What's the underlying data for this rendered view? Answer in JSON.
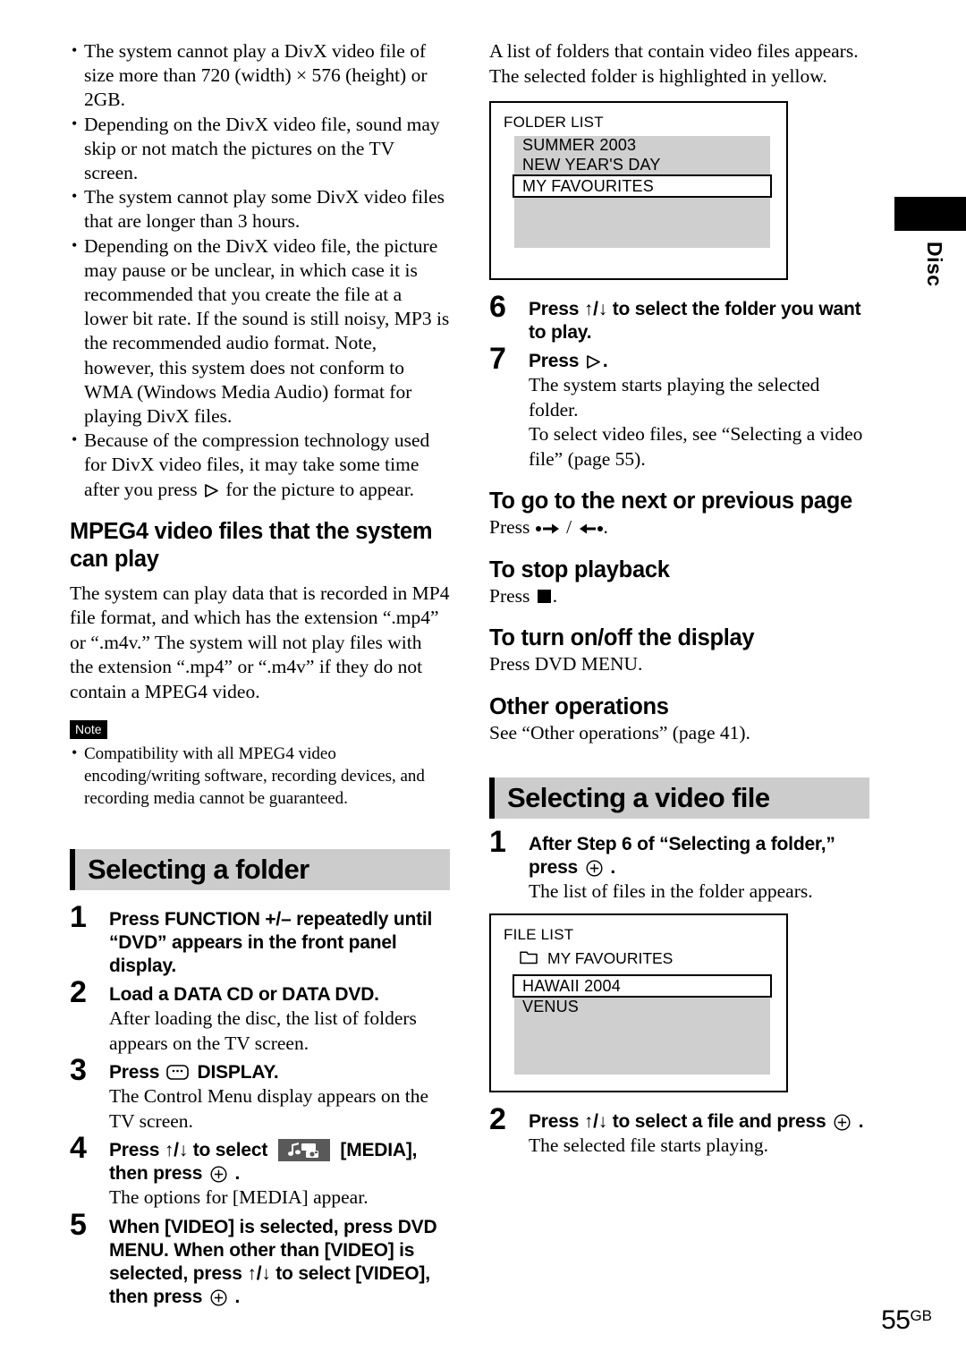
{
  "document": {
    "page_number": "55",
    "page_suffix": "GB",
    "side_tab_label": "Disc"
  },
  "left_column": {
    "intro_bullets": [
      "The system cannot play a DivX video file of size more than 720 (width) × 576 (height) or 2GB.",
      "Depending on the DivX video file, sound may skip or not match the pictures on the TV screen.",
      "The system cannot play some DivX video files that are longer than 3 hours.",
      "Depending on the DivX video file, the picture may pause or be unclear, in which case it is recommended that you create the file at a lower bit rate. If the sound is still noisy, MP3 is the recommended audio format. Note, however, this system does not conform to WMA (Windows Media Audio) format for playing DivX files."
    ],
    "bullet_compression_before": "Because of the compression technology used for DivX video files, it may take some time after you press ",
    "bullet_compression_after": " for the picture to appear.",
    "mpeg4_heading": "MPEG4 video files that the system can play",
    "mpeg4_paragraph": "The system can play data that is recorded in MP4 file format, and which has the extension “.mp4” or “.m4v.” The system will not play files with the extension “.mp4” or “.m4v” if they do not contain a MPEG4 video.",
    "note_label": "Note",
    "note_bullets": [
      "Compatibility with all MPEG4 video encoding/writing software, recording devices, and recording media cannot be guaranteed."
    ],
    "section_heading": "Selecting a folder",
    "steps": [
      {
        "number": "1",
        "instruction": "Press FUNCTION +/– repeatedly until “DVD” appears in the front panel display.",
        "body": ""
      },
      {
        "number": "2",
        "instruction": "Load a DATA CD or DATA DVD.",
        "body": "After loading the disc, the list of folders appears on the TV screen."
      },
      {
        "number": "3",
        "instruction_before": "Press ",
        "instruction_icon": "display-icon",
        "instruction_after": " DISPLAY.",
        "number_label": "3",
        "body": "The Control Menu display appears on the TV screen."
      },
      {
        "number": "4",
        "instruction_p1": "Press ↑/↓ to select ",
        "instruction_icon": "media-icon",
        "instruction_p2": " [MEDIA], then press ",
        "instruction_icon2": "enter-icon",
        "instruction_p3": " .",
        "body": "The options for [MEDIA] appear."
      },
      {
        "number": "5",
        "instruction_p1": "When [VIDEO] is selected, press DVD MENU. When other than [VIDEO] is selected, press ↑/↓ to select [VIDEO], then press ",
        "instruction_icon": "enter-icon",
        "instruction_p2": " .",
        "body": ""
      }
    ]
  },
  "right_column": {
    "intro_paragraph_1": "A list of folders that contain video files appears.",
    "intro_paragraph_2": "The selected folder is highlighted in yellow.",
    "folder_screen": {
      "title": "FOLDER LIST",
      "items": [
        {
          "label": "SUMMER 2003",
          "selected": false
        },
        {
          "label": "NEW YEAR'S DAY",
          "selected": false
        },
        {
          "label": "MY FAVOURITES",
          "selected": true
        }
      ]
    },
    "steps": [
      {
        "number": "6",
        "instruction": "Press ↑/↓ to select the folder you want to play.",
        "body": ""
      },
      {
        "number": "7",
        "instruction_before": "Press ",
        "instruction_icon": "play-icon",
        "instruction_after": ".",
        "body_1": "The system starts playing the selected folder.",
        "body_2": "To select video files, see “Selecting a video file” (page 55)."
      }
    ],
    "subheading_next_prev": "To go to the next or previous page",
    "next_prev_press_label": "Press ",
    "next_prev_separator": " / ",
    "next_prev_period": ".",
    "subheading_stop": "To stop playback",
    "stop_press_label": "Press ",
    "stop_period": ".",
    "subheading_display": "To turn on/off the display",
    "display_press": "Press DVD MENU.",
    "subheading_other": "Other operations",
    "other_body": "See “Other operations” (page 41).",
    "section_heading": "Selecting a video file",
    "video_steps": [
      {
        "number": "1",
        "instruction_p1": "After Step 6 of “Selecting a folder,” press ",
        "instruction_icon": "enter-icon",
        "instruction_p2": " .",
        "body": "The list of files in the folder appears."
      },
      {
        "number": "2",
        "instruction_p1": "Press ↑/↓ to select a file and press ",
        "instruction_icon": "enter-icon",
        "instruction_p2": " .",
        "body": "The selected file starts playing."
      }
    ],
    "file_screen": {
      "title": "FILE LIST",
      "breadcrumb": "MY FAVOURITES",
      "breadcrumb_icon": "folder-icon",
      "items": [
        {
          "label": "HAWAII 2004",
          "selected": true
        },
        {
          "label": "VENUS",
          "selected": false
        }
      ]
    }
  },
  "colors": {
    "heading_band": "#cccccc",
    "screen_list_bg": "#cfcfcf",
    "media_icon_bg": "#595959",
    "ink": "#000000"
  }
}
